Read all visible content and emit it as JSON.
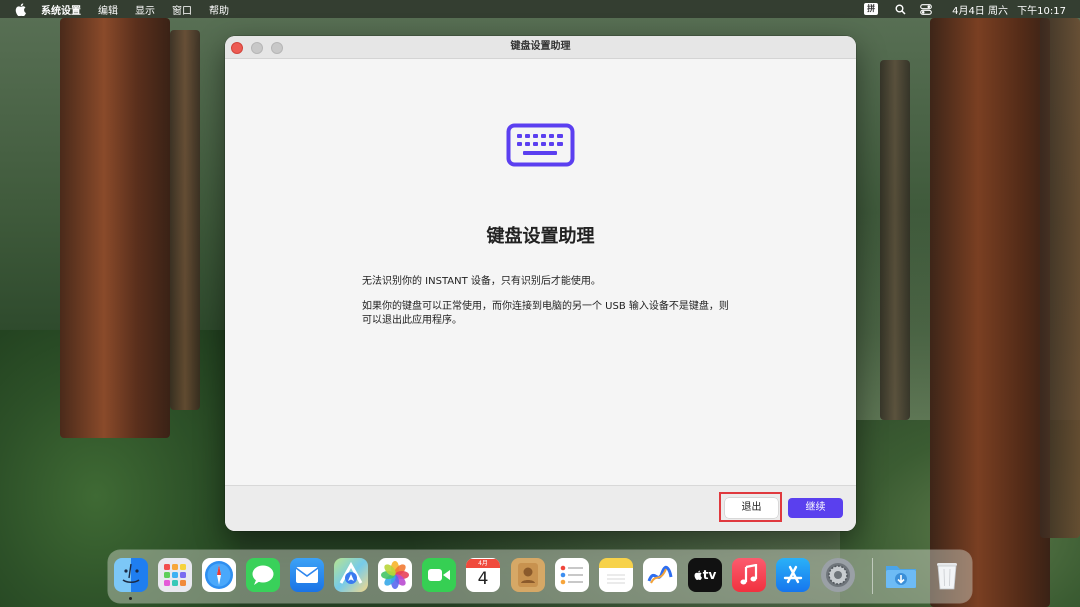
{
  "menubar": {
    "app_name": "系统设置",
    "items": [
      "编辑",
      "显示",
      "窗口",
      "帮助"
    ],
    "input_method": "拼",
    "date": "4月4日 周六",
    "time": "下午10:17"
  },
  "window": {
    "title": "键盘设置助理",
    "heading": "键盘设置助理",
    "message_1": "无法识别你的 INSTANT 设备，只有识别后才能使用。",
    "message_2": "如果你的键盘可以正常使用，而你连接到电脑的另一个 USB 输入设备不是键盘，则可以退出此应用程序。",
    "buttons": {
      "quit": "退出",
      "continue": "继续"
    }
  },
  "dock": {
    "calendar_month": "4月",
    "calendar_day": "4",
    "tv_label": "tv"
  },
  "colors": {
    "accent": "#5a40ee",
    "highlight": "#e0393e"
  }
}
